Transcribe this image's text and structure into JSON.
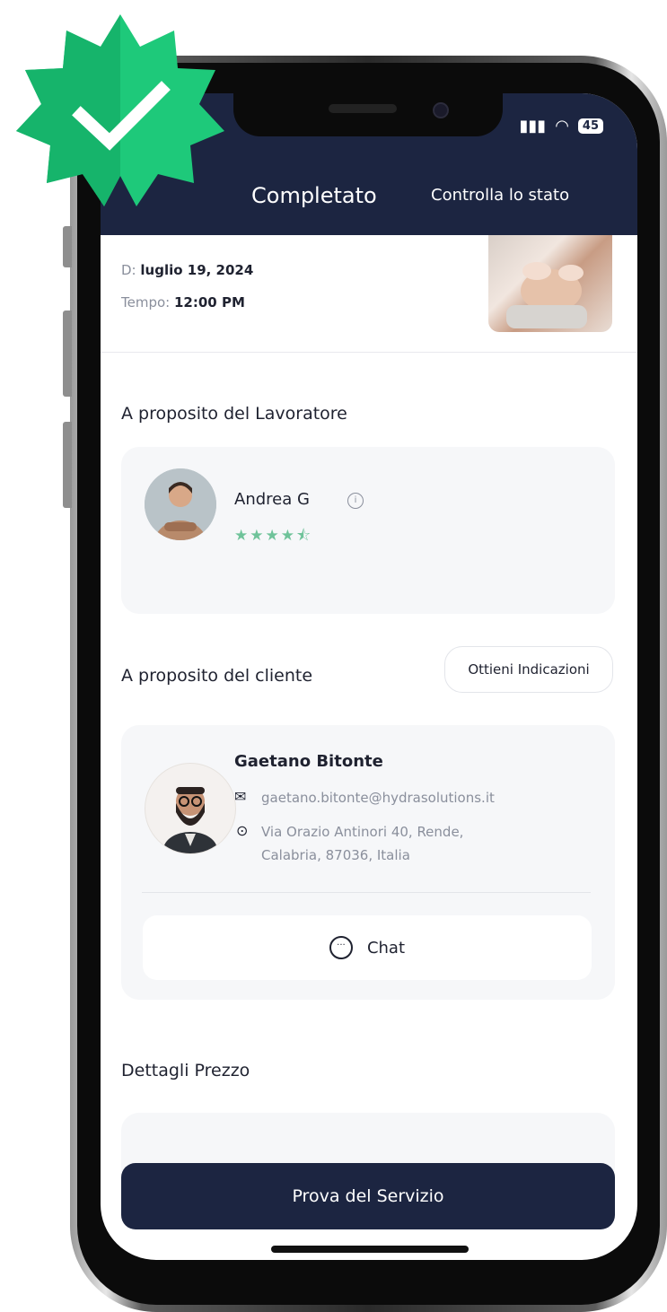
{
  "status_bar": {
    "battery": "45"
  },
  "header": {
    "title": "Completato",
    "link": "Controlla lo stato"
  },
  "booking": {
    "date_label": "D:",
    "date_value": "luglio 19, 2024",
    "time_label": "Tempo:",
    "time_value": "12:00 PM"
  },
  "worker_section": {
    "title": "A proposito del Lavoratore",
    "name": "Andrea G",
    "rating": 4.5,
    "stars": "★★★★⯪"
  },
  "client_section": {
    "title": "A proposito del cliente",
    "directions_button": "Ottieni Indicazioni",
    "name": "Gaetano Bitonte",
    "email": "gaetano.bitonte@hydrasolutions.it",
    "address_line1": "Via Orazio Antinori 40, Rende,",
    "address_line2": "Calabria, 87036, Italia",
    "chat_button": "Chat"
  },
  "price_section": {
    "title": "Dettagli Prezzo"
  },
  "footer": {
    "primary_button": "Prova del Servizio"
  },
  "icons": {
    "verified": "verified-badge-icon",
    "info": "info-icon",
    "mail": "mail-icon",
    "location": "location-pin-icon",
    "chat": "chat-bubble-icon"
  },
  "colors": {
    "header_bg": "#1c2541",
    "badge_green": "#1ec97a",
    "star_green": "#6fc39a",
    "card_bg": "#f6f7f9"
  }
}
